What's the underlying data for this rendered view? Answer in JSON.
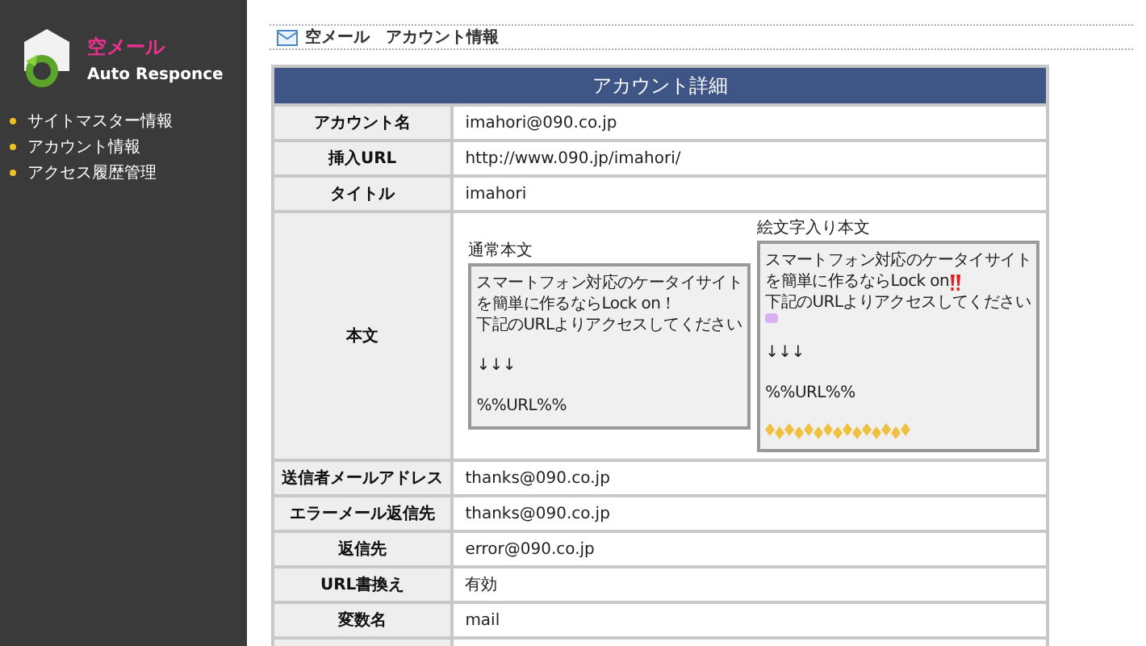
{
  "sidebar": {
    "logo": {
      "title": "空メール",
      "subtitle": "Auto Responce"
    },
    "items": [
      "サイトマスター情報",
      "アカウント情報",
      "アクセス履歴管理"
    ]
  },
  "breadcrumb": "空メール　アカウント情報",
  "table": {
    "title": "アカウント詳細",
    "rows": [
      {
        "kind": "text",
        "label": "アカウント名",
        "value": "imahori@090.co.jp"
      },
      {
        "kind": "text",
        "label": "挿入URL",
        "value": "http://www.090.jp/imahori/"
      },
      {
        "kind": "text",
        "label": "タイトル",
        "value": "imahori"
      },
      {
        "kind": "body",
        "label": "本文",
        "normal": {
          "label": "通常本文",
          "lines": [
            "スマートフォン対応のケータイサイト",
            "を簡単に作るならLock on！",
            "下記のURLよりアクセスしてください",
            "↓↓↓",
            "%%URL%%"
          ]
        },
        "emoji": {
          "label": "絵文字入り本文",
          "lines": [
            "スマートフォン対応のケータイサイト",
            "を簡単に作るならLock on",
            "下記のURLよりアクセスしてください",
            "↓↓↓",
            "%%URL%%"
          ]
        }
      },
      {
        "kind": "text",
        "label": "送信者メールアドレス",
        "value": "thanks@090.co.jp"
      },
      {
        "kind": "text",
        "label": "エラーメール返信先",
        "value": "thanks@090.co.jp"
      },
      {
        "kind": "text",
        "label": "返信先",
        "value": "error@090.co.jp"
      },
      {
        "kind": "text",
        "label": "URL書換え",
        "value": "有効"
      },
      {
        "kind": "text",
        "label": "変数名",
        "value": "mail"
      }
    ]
  }
}
